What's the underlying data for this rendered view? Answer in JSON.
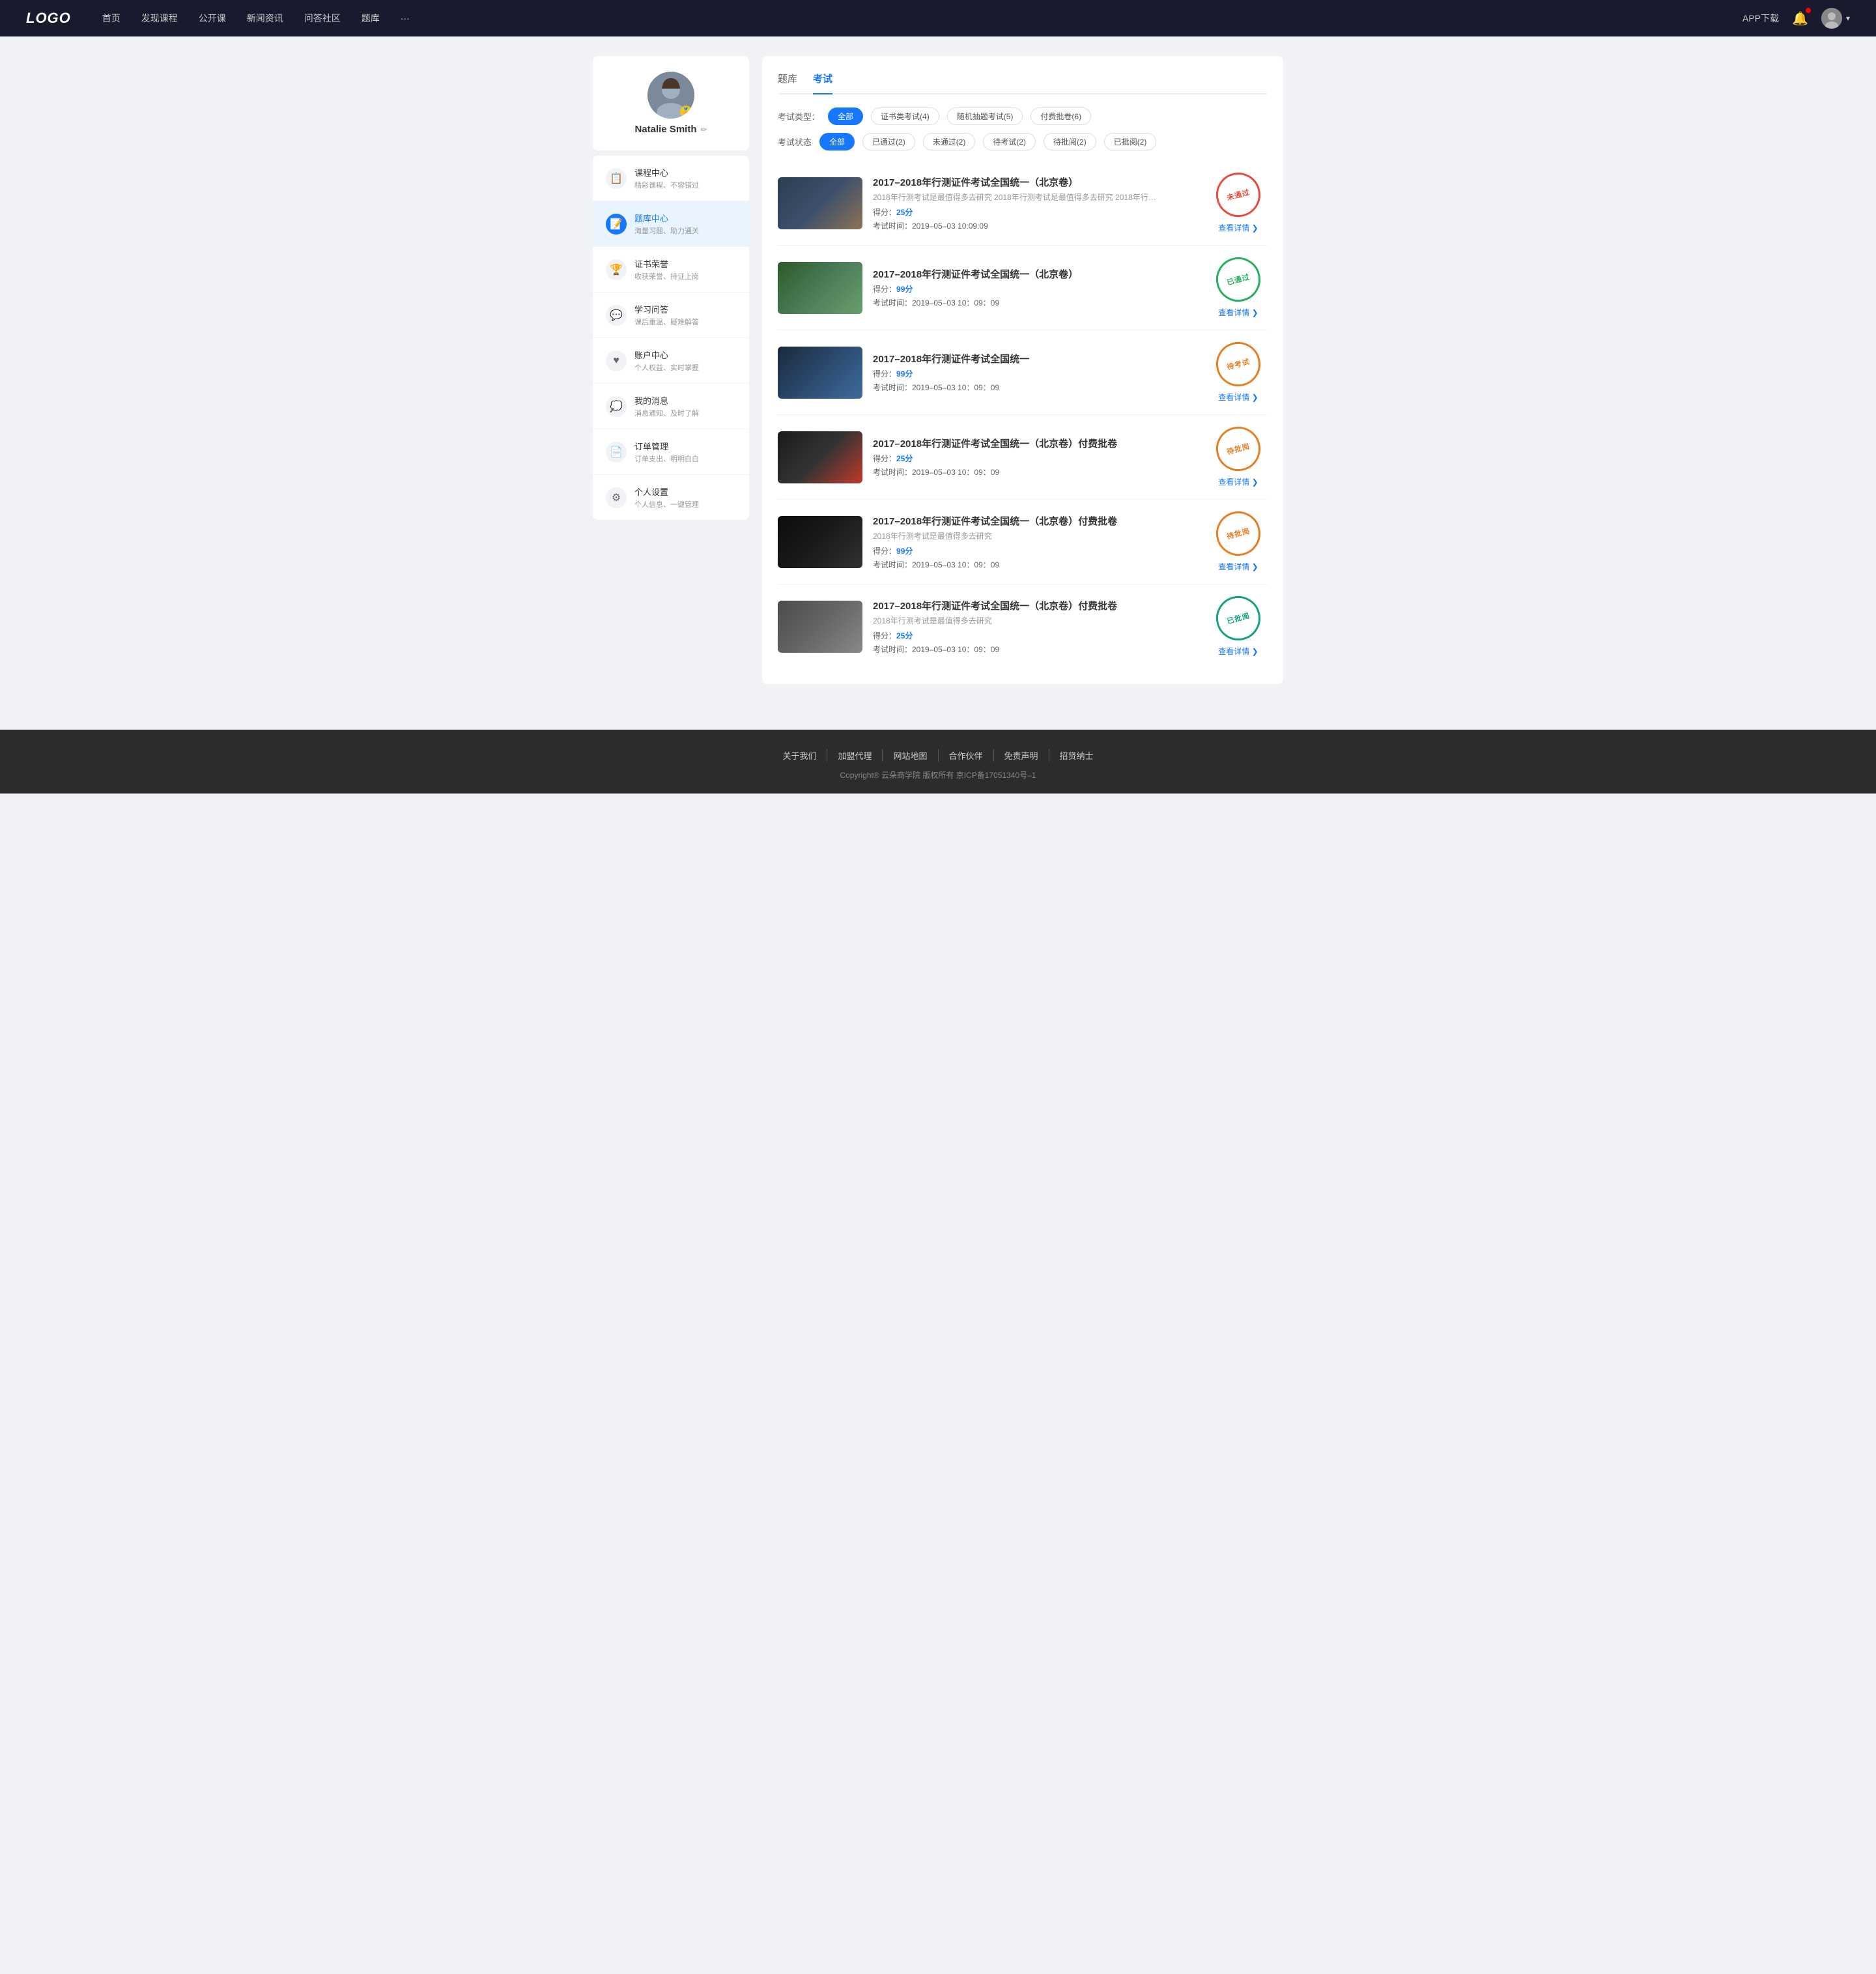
{
  "header": {
    "logo": "LOGO",
    "nav": [
      {
        "label": "首页",
        "href": "#"
      },
      {
        "label": "发现课程",
        "href": "#"
      },
      {
        "label": "公开课",
        "href": "#"
      },
      {
        "label": "新闻资讯",
        "href": "#"
      },
      {
        "label": "问答社区",
        "href": "#"
      },
      {
        "label": "题库",
        "href": "#"
      },
      {
        "label": "···",
        "href": "#"
      }
    ],
    "appDownload": "APP下载",
    "userDropdownLabel": "▾"
  },
  "sidebar": {
    "profile": {
      "name": "Natalie Smith",
      "editIcon": "✏"
    },
    "menu": [
      {
        "id": "course",
        "icon": "📋",
        "title": "课程中心",
        "subtitle": "精彩课程、不容错过",
        "active": false
      },
      {
        "id": "question-bank",
        "icon": "📝",
        "title": "题库中心",
        "subtitle": "海量习题、助力通关",
        "active": true
      },
      {
        "id": "certificate",
        "icon": "🏆",
        "title": "证书荣誉",
        "subtitle": "收获荣誉、持证上岗",
        "active": false
      },
      {
        "id": "qa",
        "icon": "💬",
        "title": "学习问答",
        "subtitle": "课后重温、疑难解答",
        "active": false
      },
      {
        "id": "account",
        "icon": "♥",
        "title": "账户中心",
        "subtitle": "个人权益、实时掌握",
        "active": false
      },
      {
        "id": "message",
        "icon": "💭",
        "title": "我的消息",
        "subtitle": "消息通知、及时了解",
        "active": false
      },
      {
        "id": "order",
        "icon": "📄",
        "title": "订单管理",
        "subtitle": "订单支出、明明白白",
        "active": false
      },
      {
        "id": "settings",
        "icon": "⚙",
        "title": "个人设置",
        "subtitle": "个人信息、一键管理",
        "active": false
      }
    ]
  },
  "content": {
    "tabs": [
      {
        "label": "题库",
        "active": false
      },
      {
        "label": "考试",
        "active": true
      }
    ],
    "filterType": {
      "label": "考试类型：",
      "options": [
        {
          "label": "全部",
          "active": true
        },
        {
          "label": "证书类考试(4)",
          "active": false
        },
        {
          "label": "随机抽题考试(5)",
          "active": false
        },
        {
          "label": "付费批卷(6)",
          "active": false
        }
      ]
    },
    "filterStatus": {
      "label": "考试状态",
      "options": [
        {
          "label": "全部",
          "active": true
        },
        {
          "label": "已通过(2)",
          "active": false
        },
        {
          "label": "未通过(2)",
          "active": false
        },
        {
          "label": "待考试(2)",
          "active": false
        },
        {
          "label": "待批阅(2)",
          "active": false
        },
        {
          "label": "已批阅(2)",
          "active": false
        }
      ]
    },
    "exams": [
      {
        "id": 1,
        "title": "2017–2018年行测证件考试全国统一（北京卷）",
        "desc": "2018年行测考试是最值得多去研究 2018年行测考试是最值得多去研究 2018年行…",
        "score": "25",
        "time": "2019–05–03  10:09:09",
        "status": "未通过",
        "statusType": "red",
        "thumbClass": "thumb-1",
        "detailLabel": "查看详情 ❯"
      },
      {
        "id": 2,
        "title": "2017–2018年行测证件考试全国统一（北京卷）",
        "desc": "",
        "score": "99",
        "time": "2019–05–03  10：09：09",
        "status": "已通过",
        "statusType": "green",
        "thumbClass": "thumb-2",
        "detailLabel": "查看详情 ❯"
      },
      {
        "id": 3,
        "title": "2017–2018年行测证件考试全国统一",
        "desc": "",
        "score": "99",
        "time": "2019–05–03  10：09：09",
        "status": "待考试",
        "statusType": "orange",
        "thumbClass": "thumb-3",
        "detailLabel": "查看详情 ❯"
      },
      {
        "id": 4,
        "title": "2017–2018年行测证件考试全国统一（北京卷）付费批卷",
        "desc": "",
        "score": "25",
        "time": "2019–05–03  10：09：09",
        "status": "待批阅",
        "statusType": "orange",
        "thumbClass": "thumb-4",
        "detailLabel": "查看详情 ❯"
      },
      {
        "id": 5,
        "title": "2017–2018年行测证件考试全国统一（北京卷）付费批卷",
        "desc": "2018年行测考试是最值得多去研究",
        "score": "99",
        "time": "2019–05–03  10：09：09",
        "status": "待批阅",
        "statusType": "orange",
        "thumbClass": "thumb-5",
        "detailLabel": "查看详情 ❯"
      },
      {
        "id": 6,
        "title": "2017–2018年行测证件考试全国统一（北京卷）付费批卷",
        "desc": "2018年行测考试是最值得多去研究",
        "score": "25",
        "time": "2019–05–03  10：09：09",
        "status": "已批阅",
        "statusType": "teal",
        "thumbClass": "thumb-6",
        "detailLabel": "查看详情 ❯"
      }
    ]
  },
  "footer": {
    "links": [
      "关于我们",
      "加盟代理",
      "网站地图",
      "合作伙伴",
      "免责声明",
      "招贤纳士"
    ],
    "copyright": "Copyright® 云朵商学院  版权所有    京ICP备17051340号–1"
  }
}
